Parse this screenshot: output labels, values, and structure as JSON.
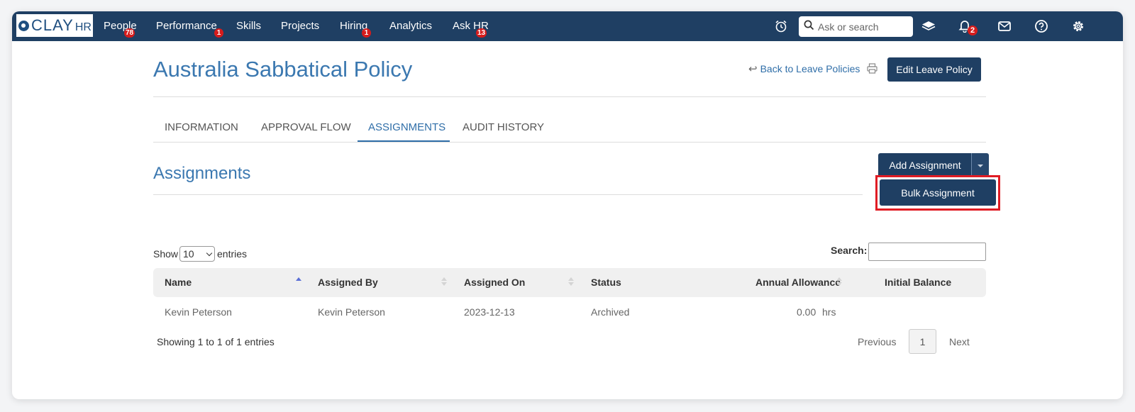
{
  "nav": {
    "logo_text": "CLAY",
    "logo_suffix": "HR",
    "items": [
      {
        "label": "People",
        "badge": "78"
      },
      {
        "label": "Performance",
        "badge": "1"
      },
      {
        "label": "Skills"
      },
      {
        "label": "Projects"
      },
      {
        "label": "Hiring",
        "badge": "1"
      },
      {
        "label": "Analytics"
      },
      {
        "label": "Ask HR",
        "badge": "13"
      }
    ],
    "search_placeholder": "Ask or search",
    "notification_count": "2",
    "icons": [
      "alarm-clock-icon",
      "search-icon",
      "layers-icon",
      "bell-icon",
      "mail-icon",
      "help-icon",
      "gear-icon"
    ]
  },
  "page": {
    "title": "Australia Sabbatical Policy",
    "back_link": "Back to Leave Policies",
    "edit_button": "Edit Leave Policy"
  },
  "tabs": [
    {
      "label": "INFORMATION"
    },
    {
      "label": "APPROVAL FLOW"
    },
    {
      "label": "ASSIGNMENTS",
      "active": true
    },
    {
      "label": "AUDIT HISTORY"
    }
  ],
  "assignments": {
    "title": "Assignments",
    "add_button": "Add Assignment",
    "dropdown_item": "Bulk Assignment"
  },
  "table": {
    "show_label": "Show",
    "entries_label": "entries",
    "page_size": "10",
    "search_label": "Search:",
    "columns": [
      "Name",
      "Assigned By",
      "Assigned On",
      "Status",
      "Annual Allowance",
      "Initial Balance"
    ],
    "rows": [
      {
        "name": "Kevin Peterson",
        "assigned_by": "Kevin Peterson",
        "assigned_on": "2023-12-13",
        "status": "Archived",
        "annual_allowance": "0.00",
        "unit": "hrs",
        "initial_balance": ""
      }
    ],
    "info": "Showing 1 to 1 of 1 entries",
    "pagination": {
      "previous": "Previous",
      "current": "1",
      "next": "Next"
    }
  },
  "colors": {
    "nav_bg": "#1f3f63",
    "accent": "#3b78b0",
    "badge": "#d61c1c",
    "highlight": "#e01c24"
  }
}
